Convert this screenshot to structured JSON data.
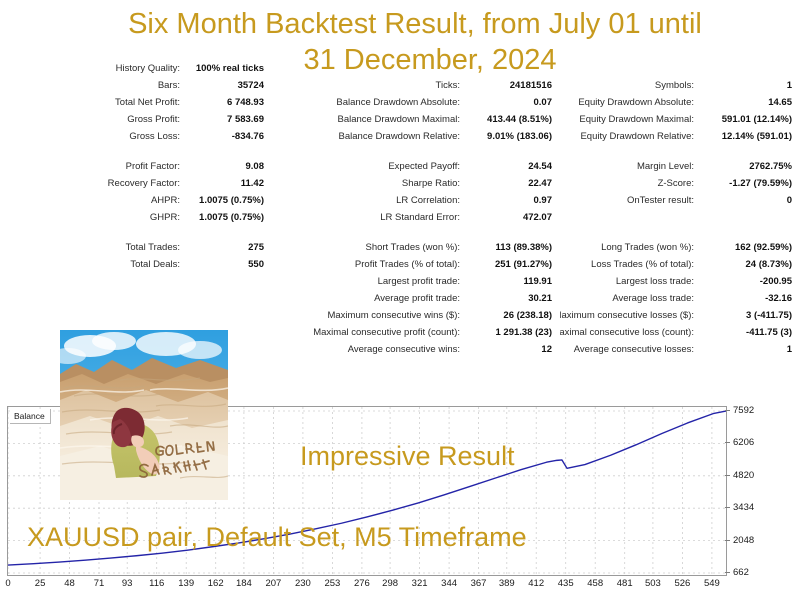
{
  "title": {
    "line1": "Six Month Backtest Result, from July 01 until",
    "line2": "31 December, 2024",
    "color": "#c79a1e"
  },
  "captions": {
    "impressive": "Impressive Result",
    "pair_info": "XAUUSD pair, Default Set, M5 Timeframe"
  },
  "logo": {
    "brand_line1": "GOLDEN",
    "brand_line2": "SAHARA",
    "alt": "desert-illustration-woman-sitting-on-sand-dunes"
  },
  "report": {
    "groups": [
      {
        "rows": [
          {
            "c1": {
              "label": "History Quality:",
              "value": "100% real ticks"
            },
            "c2": {
              "label": "",
              "value": ""
            },
            "c3": {
              "label": "",
              "value": ""
            }
          },
          {
            "c1": {
              "label": "Bars:",
              "value": "35724"
            },
            "c2": {
              "label": "Ticks:",
              "value": "24181516"
            },
            "c3": {
              "label": "Symbols:",
              "value": "1"
            }
          },
          {
            "c1": {
              "label": "Total Net Profit:",
              "value": "6 748.93"
            },
            "c2": {
              "label": "Balance Drawdown Absolute:",
              "value": "0.07"
            },
            "c3": {
              "label": "Equity Drawdown Absolute:",
              "value": "14.65"
            }
          },
          {
            "c1": {
              "label": "Gross Profit:",
              "value": "7 583.69"
            },
            "c2": {
              "label": "Balance Drawdown Maximal:",
              "value": "413.44 (8.51%)"
            },
            "c3": {
              "label": "Equity Drawdown Maximal:",
              "value": "591.01 (12.14%)"
            }
          },
          {
            "c1": {
              "label": "Gross Loss:",
              "value": "-834.76"
            },
            "c2": {
              "label": "Balance Drawdown Relative:",
              "value": "9.01% (183.06)"
            },
            "c3": {
              "label": "Equity Drawdown Relative:",
              "value": "12.14% (591.01)"
            }
          }
        ]
      },
      {
        "rows": [
          {
            "c1": {
              "label": "Profit Factor:",
              "value": "9.08"
            },
            "c2": {
              "label": "Expected Payoff:",
              "value": "24.54"
            },
            "c3": {
              "label": "Margin Level:",
              "value": "2762.75%"
            }
          },
          {
            "c1": {
              "label": "Recovery Factor:",
              "value": "11.42"
            },
            "c2": {
              "label": "Sharpe Ratio:",
              "value": "22.47"
            },
            "c3": {
              "label": "Z-Score:",
              "value": "-1.27 (79.59%)"
            }
          },
          {
            "c1": {
              "label": "AHPR:",
              "value": "1.0075 (0.75%)"
            },
            "c2": {
              "label": "LR Correlation:",
              "value": "0.97"
            },
            "c3": {
              "label": "OnTester result:",
              "value": "0"
            }
          },
          {
            "c1": {
              "label": "GHPR:",
              "value": "1.0075 (0.75%)"
            },
            "c2": {
              "label": "LR Standard Error:",
              "value": "472.07"
            },
            "c3": {
              "label": "",
              "value": ""
            }
          }
        ]
      },
      {
        "rows": [
          {
            "c1": {
              "label": "Total Trades:",
              "value": "275"
            },
            "c2": {
              "label": "Short Trades (won %):",
              "value": "113 (89.38%)"
            },
            "c3": {
              "label": "Long Trades (won %):",
              "value": "162 (92.59%)"
            }
          },
          {
            "c1": {
              "label": "Total Deals:",
              "value": "550"
            },
            "c2": {
              "label": "Profit Trades (% of total):",
              "value": "251 (91.27%)"
            },
            "c3": {
              "label": "Loss Trades (% of total):",
              "value": "24 (8.73%)"
            }
          },
          {
            "c1": {
              "label": "",
              "value": ""
            },
            "c2": {
              "label": "Largest profit trade:",
              "value": "119.91"
            },
            "c3": {
              "label": "Largest loss trade:",
              "value": "-200.95"
            }
          },
          {
            "c1": {
              "label": "",
              "value": ""
            },
            "c2": {
              "label": "Average profit trade:",
              "value": "30.21"
            },
            "c3": {
              "label": "Average loss trade:",
              "value": "-32.16"
            }
          },
          {
            "c1": {
              "label": "",
              "value": ""
            },
            "c2": {
              "label": "Maximum consecutive wins ($):",
              "value": "26 (238.18)"
            },
            "c3": {
              "label": "Maximum consecutive losses ($):",
              "value": "3 (-411.75)"
            }
          },
          {
            "c1": {
              "label": "",
              "value": ""
            },
            "c2": {
              "label": "Maximal consecutive profit (count):",
              "value": "1 291.38 (23)"
            },
            "c3": {
              "label": "Maximal consecutive loss (count):",
              "value": "-411.75 (3)"
            }
          },
          {
            "c1": {
              "label": "",
              "value": ""
            },
            "c2": {
              "label": "Average consecutive wins:",
              "value": "12"
            },
            "c3": {
              "label": "Average consecutive losses:",
              "value": "1"
            }
          }
        ]
      }
    ]
  },
  "chart_data": {
    "type": "line",
    "title": "",
    "legend": "Balance",
    "legend_position": "top-left",
    "line_color": "#2424a8",
    "grid": true,
    "xlabel": "",
    "ylabel": "",
    "xlim": [
      0,
      560
    ],
    "ylim": [
      662,
      7592
    ],
    "xticks": [
      0,
      25,
      48,
      71,
      93,
      116,
      139,
      162,
      184,
      207,
      230,
      253,
      276,
      298,
      321,
      344,
      367,
      389,
      412,
      435,
      458,
      481,
      503,
      526,
      549
    ],
    "yticks": [
      662,
      2048,
      3434,
      4820,
      6206,
      7592
    ],
    "series": [
      {
        "name": "Balance",
        "x": [
          0,
          20,
          40,
          60,
          80,
          100,
          120,
          140,
          160,
          180,
          200,
          220,
          240,
          260,
          280,
          300,
          320,
          340,
          360,
          380,
          400,
          420,
          428,
          432,
          436,
          450,
          470,
          490,
          510,
          530,
          550,
          560
        ],
        "y": [
          1000,
          1060,
          1130,
          1210,
          1300,
          1400,
          1510,
          1640,
          1790,
          1950,
          2130,
          2330,
          2550,
          2790,
          3060,
          3350,
          3660,
          4000,
          4360,
          4720,
          5080,
          5400,
          5480,
          5500,
          5140,
          5300,
          5700,
          6150,
          6630,
          7080,
          7480,
          7592
        ]
      }
    ]
  }
}
